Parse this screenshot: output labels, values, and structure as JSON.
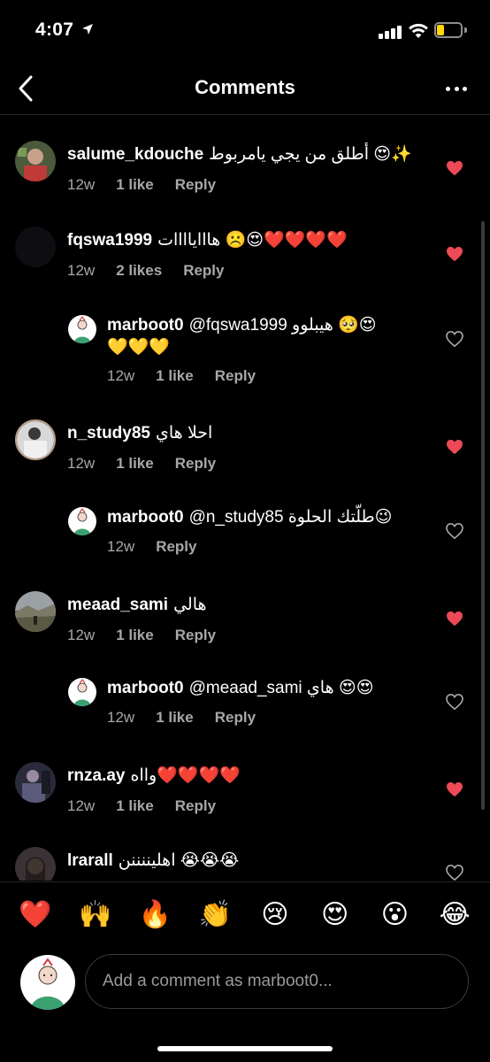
{
  "status_bar": {
    "time": "4:07",
    "battery_level": 0.3
  },
  "nav": {
    "title": "Comments"
  },
  "comments": [
    {
      "username": "salume_kdouche",
      "text": "أطلق من يجي يامربوط",
      "emoji": "😍✨",
      "time": "12w",
      "likes": "1 like",
      "reply": "Reply",
      "liked": true
    },
    {
      "username": "fqswa1999",
      "text": "هاااياااات",
      "emoji": "☹️😍❤️❤️❤️❤️",
      "time": "12w",
      "likes": "2 likes",
      "reply": "Reply",
      "liked": true
    },
    {
      "username": "marboot0",
      "text": "@fqswa1999 هيبلوو",
      "emoji": "🥺😍",
      "emoji_line2": "💛💛💛",
      "time": "12w",
      "likes": "1 like",
      "reply": "Reply",
      "liked": false
    },
    {
      "username": "n_study85",
      "text": "احلا هاي",
      "emoji": "",
      "time": "12w",
      "likes": "1 like",
      "reply": "Reply",
      "liked": true
    },
    {
      "username": "marboot0",
      "text": "@n_study85 طلّتك الحلوة",
      "emoji": "😉",
      "time": "12w",
      "likes": "",
      "reply": "Reply",
      "liked": false
    },
    {
      "username": "meaad_sami",
      "text": "هالي",
      "emoji": "",
      "time": "12w",
      "likes": "1 like",
      "reply": "Reply",
      "liked": true
    },
    {
      "username": "marboot0",
      "text": "@meaad_sami هاي",
      "emoji": "😍😍",
      "time": "12w",
      "likes": "1 like",
      "reply": "Reply",
      "liked": false
    },
    {
      "username": "rnza.ay",
      "text": "وااه",
      "emoji": "❤️❤️❤️❤️",
      "time": "12w",
      "likes": "1 like",
      "reply": "Reply",
      "liked": true
    },
    {
      "username": "lrarall",
      "text": "اهليننننن",
      "emoji": "😭😭😭",
      "time": "",
      "likes": "",
      "reply": "",
      "liked": false
    }
  ],
  "reactions": [
    "❤️",
    "🙌",
    "🔥",
    "👏",
    "😢",
    "😍",
    "😮",
    "😂"
  ],
  "composer": {
    "placeholder": "Add a comment as marboot0..."
  },
  "colors": {
    "like_red": "#ed4956",
    "muted": "#a8a8a8"
  }
}
